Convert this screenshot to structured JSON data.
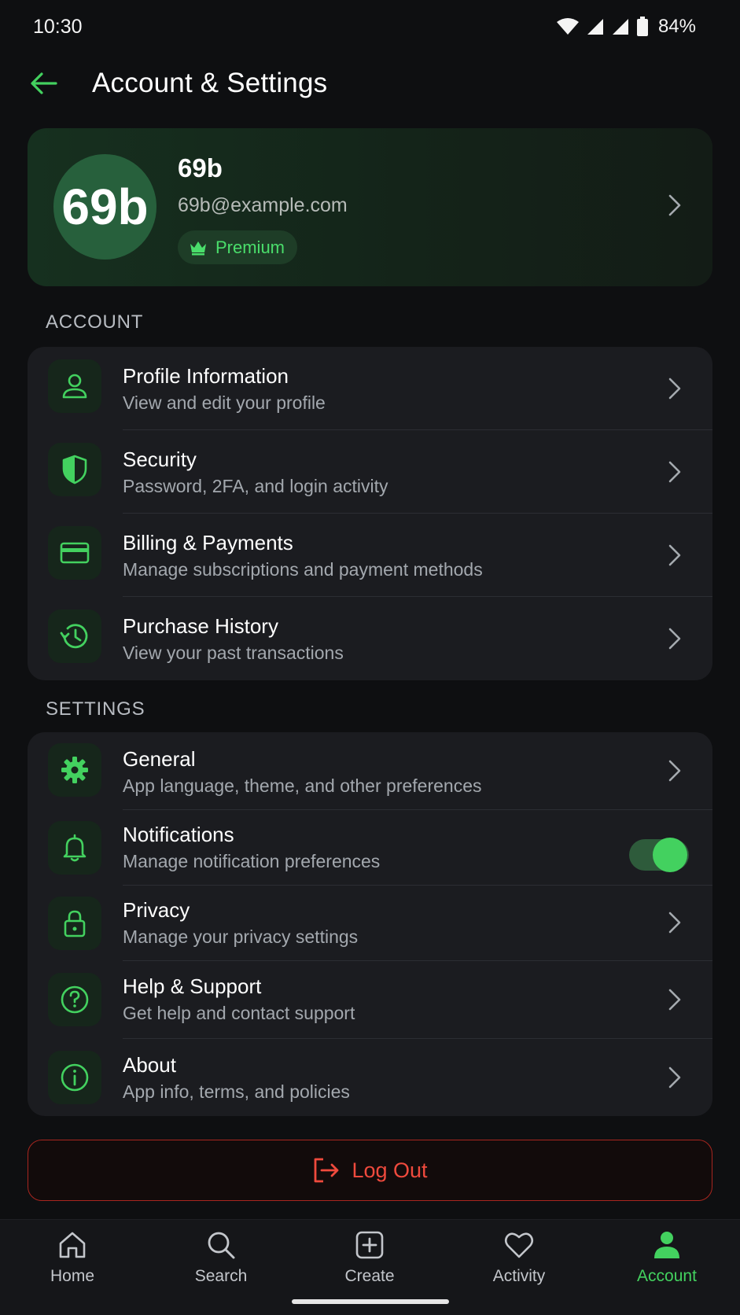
{
  "status_bar": {
    "time": "10:30",
    "battery": "84%"
  },
  "header": {
    "title": "Account & Settings"
  },
  "profile": {
    "avatar_text": "69b",
    "name": "69b",
    "email": "69b@example.com",
    "badge": "Premium"
  },
  "account_section": {
    "label": "ACCOUNT",
    "items": [
      {
        "title": "Profile Information",
        "subtitle": "View and edit your profile",
        "icon": "person-icon"
      },
      {
        "title": "Security",
        "subtitle": "Password, 2FA, and login activity",
        "icon": "shield-icon"
      },
      {
        "title": "Billing & Payments",
        "subtitle": "Manage subscriptions and payment methods",
        "icon": "credit-card-icon"
      },
      {
        "title": "Purchase History",
        "subtitle": "View your past transactions",
        "icon": "history-icon"
      }
    ]
  },
  "settings_section": {
    "label": "SETTINGS",
    "items": [
      {
        "title": "General",
        "subtitle": "App language, theme, and other preferences",
        "icon": "gear-icon"
      },
      {
        "title": "Notifications",
        "subtitle": "Manage notification preferences",
        "icon": "bell-icon",
        "toggle_on": true
      },
      {
        "title": "Privacy",
        "subtitle": "Manage your privacy settings",
        "icon": "lock-icon"
      },
      {
        "title": "Help & Support",
        "subtitle": "Get help and contact support",
        "icon": "help-icon"
      },
      {
        "title": "About",
        "subtitle": "App info, terms, and policies",
        "icon": "info-icon"
      }
    ]
  },
  "logout": {
    "label": "Log Out"
  },
  "bottom_nav": {
    "items": [
      {
        "label": "Home",
        "icon": "home-icon"
      },
      {
        "label": "Search",
        "icon": "search-icon"
      },
      {
        "label": "Create",
        "icon": "create-icon"
      },
      {
        "label": "Activity",
        "icon": "heart-icon"
      },
      {
        "label": "Account",
        "icon": "account-icon",
        "active": true
      }
    ]
  },
  "colors": {
    "accent": "#43d15f",
    "background": "#0e0f11",
    "card": "#1b1c20",
    "danger": "#ef4a3d"
  }
}
